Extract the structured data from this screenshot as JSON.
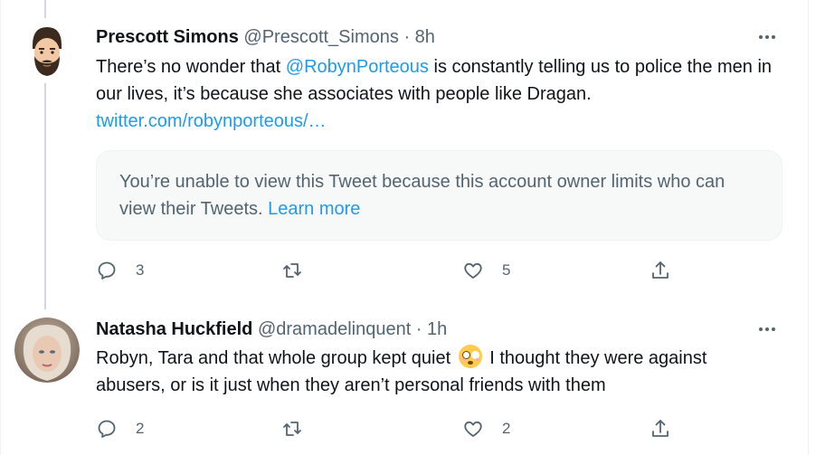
{
  "tweets": [
    {
      "name": "Prescott Simons",
      "handle": "@Prescott_Simons",
      "dot": "·",
      "time": "8h",
      "text_before": "There’s no wonder that ",
      "mention": "@RobynPorteous",
      "text_after": " is constantly telling us to police the men in our lives, it’s because she associates with people like Dragan.",
      "link": "twitter.com/robynporteous/…",
      "card": {
        "message": "You’re unable to view this Tweet because this account owner limits who can view their Tweets.",
        "learn_more": "Learn more"
      },
      "reply_count": "3",
      "retweet_count": "",
      "like_count": "5",
      "avatar_icon": "bearded-man-avatar"
    },
    {
      "name": "Natasha Huckfield",
      "handle": "@dramadelinquent",
      "dot": "·",
      "time": "1h",
      "text_line1_a": "Robyn, Tara and that whole group kept quiet",
      "emoji": "flushed-face-emoji",
      "text_line1_b": " I thought they were against",
      "text_line2": "abusers, or is it just when they aren’t personal friends with them",
      "reply_count": "2",
      "retweet_count": "",
      "like_count": "2",
      "avatar_icon": "profile-photo-avatar"
    }
  ],
  "icons": {
    "reply": "reply-icon",
    "retweet": "retweet-icon",
    "like": "heart-icon",
    "share": "share-icon",
    "more": "more-icon"
  },
  "colors": {
    "link": "#1d9bf0",
    "secondary_text": "#536471",
    "thread_line": "#cfd9de",
    "card_bg": "#f7f9f9"
  }
}
